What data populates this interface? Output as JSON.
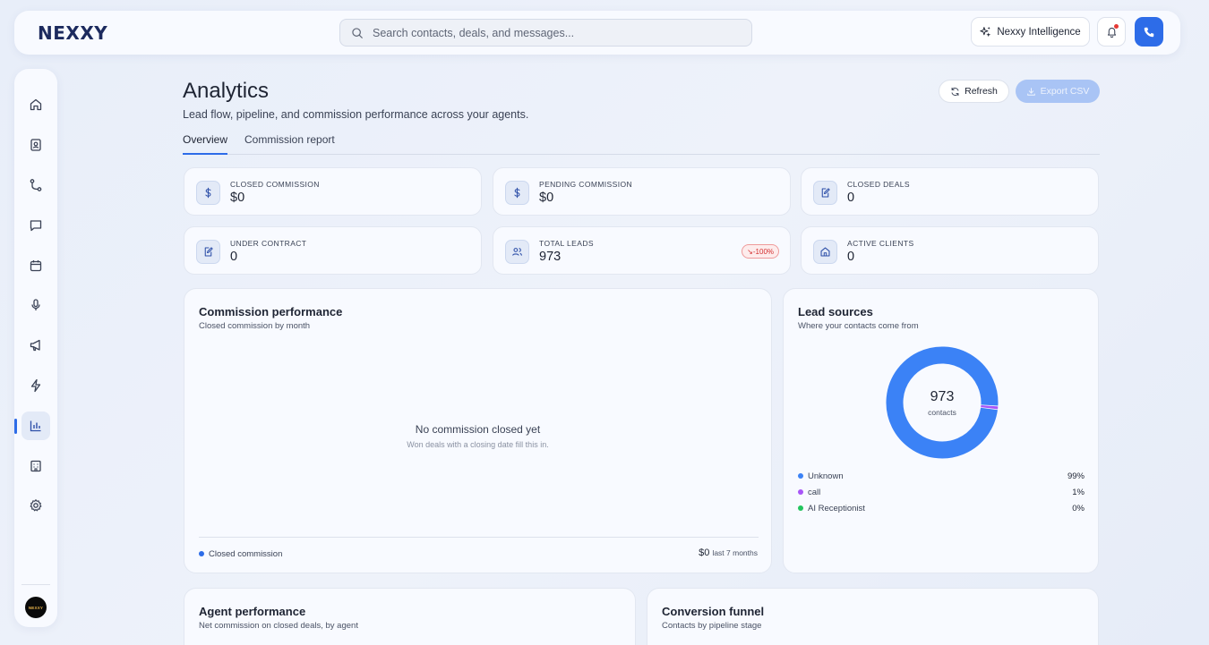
{
  "header": {
    "logo": "NEXXY",
    "search_placeholder": "Search contacts, deals, and messages...",
    "intelligence_label": "Nexxy Intelligence"
  },
  "sidebar": {
    "items": [
      {
        "name": "home-icon"
      },
      {
        "name": "contacts-icon"
      },
      {
        "name": "pipeline-icon"
      },
      {
        "name": "messages-icon"
      },
      {
        "name": "calendar-icon"
      },
      {
        "name": "microphone-icon"
      },
      {
        "name": "megaphone-icon"
      },
      {
        "name": "lightning-icon"
      },
      {
        "name": "analytics-icon",
        "active": true
      },
      {
        "name": "building-icon"
      },
      {
        "name": "settings-icon"
      }
    ],
    "avatar_text": "NEXXY"
  },
  "page": {
    "title": "Analytics",
    "subtitle": "Lead flow, pipeline, and commission performance across your agents.",
    "refresh_label": "Refresh",
    "export_label": "Export CSV",
    "tabs": [
      {
        "label": "Overview",
        "active": true
      },
      {
        "label": "Commission report",
        "active": false
      }
    ]
  },
  "stats": [
    {
      "label": "CLOSED COMMISSION",
      "value": "$0",
      "icon": "dollar-icon"
    },
    {
      "label": "PENDING COMMISSION",
      "value": "$0",
      "icon": "dollar-icon"
    },
    {
      "label": "CLOSED DEALS",
      "value": "0",
      "icon": "document-edit-icon"
    },
    {
      "label": "UNDER CONTRACT",
      "value": "0",
      "icon": "document-edit-icon"
    },
    {
      "label": "TOTAL LEADS",
      "value": "973",
      "icon": "users-icon",
      "badge": "↘-100%"
    },
    {
      "label": "ACTIVE CLIENTS",
      "value": "0",
      "icon": "house-icon"
    }
  ],
  "commission": {
    "title": "Commission performance",
    "subtitle": "Closed commission by month",
    "empty_title": "No commission closed yet",
    "empty_sub": "Won deals with a closing date fill this in.",
    "legend": "Closed commission",
    "total": "$0",
    "total_period": "last 7 months"
  },
  "lead_sources": {
    "title": "Lead sources",
    "subtitle": "Where your contacts come from",
    "total": "973",
    "total_label": "contacts"
  },
  "chart_data": {
    "type": "pie",
    "categories": [
      "Unknown",
      "call",
      "AI Receptionist"
    ],
    "values": [
      99,
      1,
      0
    ],
    "labels": [
      "99%",
      "1%",
      "0%"
    ],
    "colors": [
      "#3b82f6",
      "#a855f7",
      "#22c55e"
    ]
  },
  "agent_performance": {
    "title": "Agent performance",
    "subtitle": "Net commission on closed deals, by agent"
  },
  "funnel": {
    "title": "Conversion funnel",
    "subtitle": "Contacts by pipeline stage"
  }
}
